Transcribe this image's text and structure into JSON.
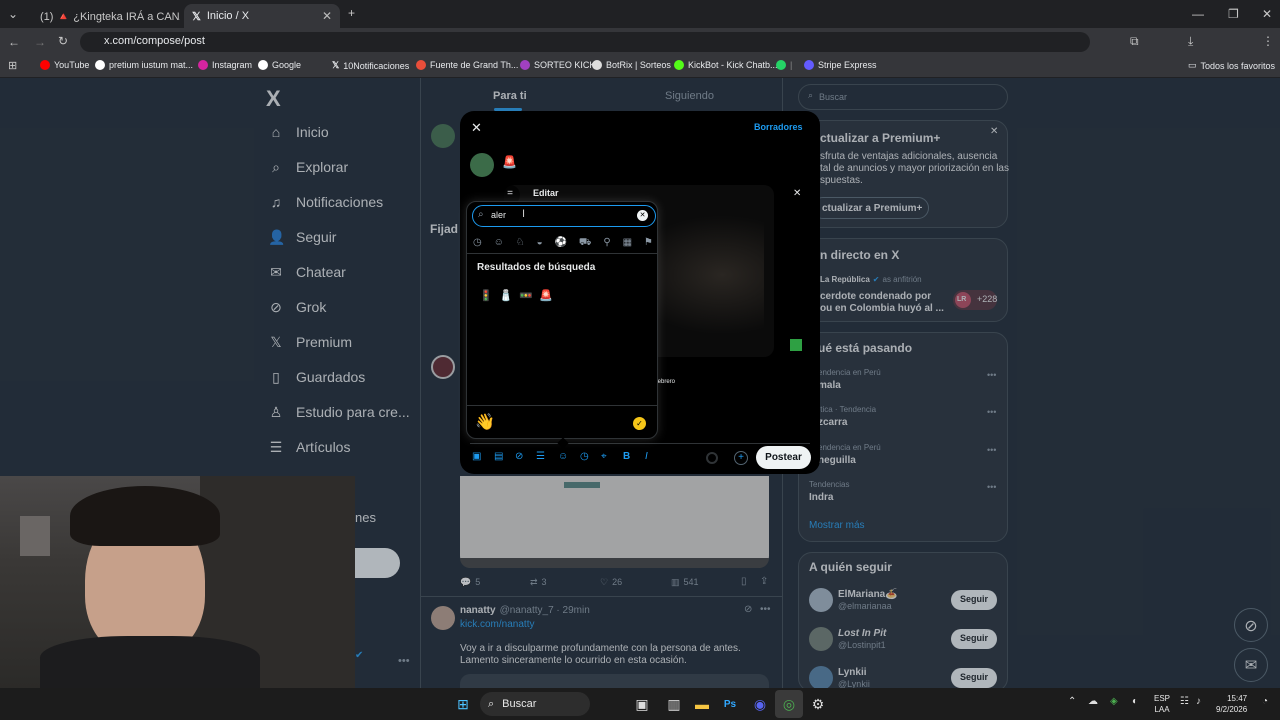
{
  "browser": {
    "tabs": [
      {
        "label": "(1) 🔺 ¿Kingteka IRÁ a CANAT"
      },
      {
        "label": "Inicio / X"
      }
    ],
    "url": "x.com/compose/post",
    "bookmarks": [
      "YouTube",
      "pretium iustum mat...",
      "Instagram",
      "Google",
      "10Notificaciones",
      "Fuente de Grand Th...",
      "SORTEO KICK",
      "BotRix | Sorteos",
      "KickBot - Kick Chatb...",
      "Stripe Express"
    ],
    "all_favorites": "Todos los favoritos"
  },
  "x": {
    "logo": "X",
    "nav": [
      {
        "label": "Inicio",
        "icon": "home-icon"
      },
      {
        "label": "Explorar",
        "icon": "search-icon"
      },
      {
        "label": "Notificaciones",
        "icon": "bell-icon"
      },
      {
        "label": "Seguir",
        "icon": "follow-icon"
      },
      {
        "label": "Chatear",
        "icon": "mail-icon"
      },
      {
        "label": "Grok",
        "icon": "grok-icon"
      },
      {
        "label": "Premium",
        "icon": "x-icon"
      },
      {
        "label": "Guardados",
        "icon": "bookmark-icon"
      },
      {
        "label": "Estudio para cre...",
        "icon": "studio-icon"
      },
      {
        "label": "Artículos",
        "icon": "articles-icon"
      }
    ],
    "nav_partial": "nes",
    "feed_tabs": [
      "Para ti",
      "Siguiendo"
    ],
    "pinned_label": "Fijad",
    "post_stats": {
      "replies": "5",
      "reposts": "3",
      "likes": "26",
      "views": "541"
    },
    "post2": {
      "name": "nanatty",
      "handle": "@nanatty_7 · 29min",
      "link": "kick.com/nanatty",
      "text1": "Voy a ir a disculparme profundamente con la persona de antes.",
      "text2": "Lamento sinceramente lo ocurrido en esta ocasión."
    },
    "search_placeholder": "Buscar",
    "premium": {
      "title": "ctualizar a Premium+",
      "body1": "sfruta de ventajas adicionales, ausencia",
      "body2": "tal de anuncios y mayor priorización en las",
      "body3": "spuestas.",
      "button": "ctualizar a Premium+"
    },
    "live": {
      "title": "n directo en X",
      "host": "La República",
      "host_suffix": "as anfitrión",
      "line1": "cerdote condenado por",
      "line2": "ou en Colombia huyó al ...",
      "count": "+228"
    },
    "trending": {
      "title": "ué está pasando",
      "items": [
        {
          "meta": "endencia en Perú",
          "name": "mala"
        },
        {
          "meta": "ítica · Tendencia",
          "name": "zcarra"
        },
        {
          "meta": "endencia en Perú",
          "name": "neguilla"
        },
        {
          "meta": "Tendencias",
          "name": "Indra"
        }
      ],
      "more": "Mostrar más"
    },
    "follow": {
      "title": "A quién seguir",
      "users": [
        {
          "name": "ElMariana🍝",
          "handle": "@elmarianaa"
        },
        {
          "name": "Lost In Pit",
          "handle": "@Lostinpit1"
        },
        {
          "name": "Lynkii",
          "handle": "@Lynkii"
        }
      ],
      "button": "Seguir"
    }
  },
  "compose": {
    "drafts": "Borradores",
    "edit": "Editar",
    "post_button": "Postear",
    "emoji_search_value": "aler",
    "results_title": "Resultados de búsqueda",
    "results": [
      "🚦",
      "🧂",
      "🚥",
      "🚨"
    ],
    "wave": "👋",
    "month": "febrero"
  },
  "taskbar": {
    "search": "Buscar",
    "lang1": "ESP",
    "lang2": "LAA",
    "time": "15:47",
    "date": "9/2/2026"
  }
}
